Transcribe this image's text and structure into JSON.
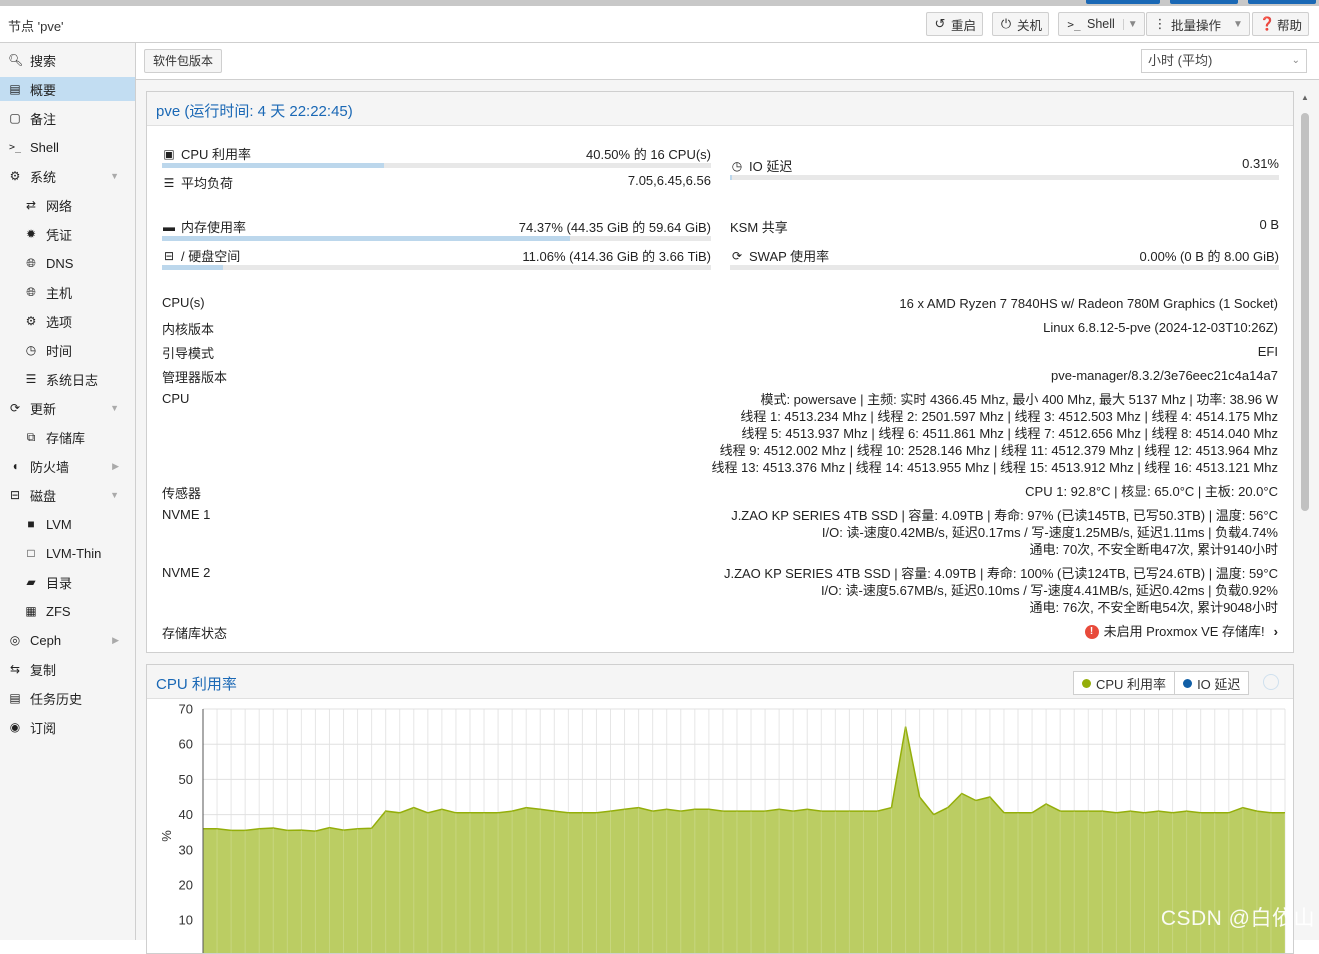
{
  "window": {
    "title": "节点 'pve'"
  },
  "header_buttons": {
    "restart": "重启",
    "shutdown": "关机",
    "shell": "Shell",
    "bulk": "批量操作",
    "help": "帮助"
  },
  "sidebar": {
    "items": [
      {
        "label": "搜索",
        "icon": "search-icon"
      },
      {
        "label": "概要",
        "icon": "book-icon"
      },
      {
        "label": "备注",
        "icon": "note-icon"
      },
      {
        "label": "Shell",
        "icon": "terminal-icon"
      },
      {
        "label": "系统",
        "icon": "gears-icon"
      },
      {
        "label": "网络",
        "icon": "exchange-icon"
      },
      {
        "label": "凭证",
        "icon": "certificate-icon"
      },
      {
        "label": "DNS",
        "icon": "globe-icon"
      },
      {
        "label": "主机",
        "icon": "globe-icon"
      },
      {
        "label": "选项",
        "icon": "gear-icon"
      },
      {
        "label": "时间",
        "icon": "clock-icon"
      },
      {
        "label": "系统日志",
        "icon": "list-icon"
      },
      {
        "label": "更新",
        "icon": "refresh-icon"
      },
      {
        "label": "存储库",
        "icon": "files-icon"
      },
      {
        "label": "防火墙",
        "icon": "shield-icon"
      },
      {
        "label": "磁盘",
        "icon": "hdd-icon"
      },
      {
        "label": "LVM",
        "icon": "square-icon"
      },
      {
        "label": "LVM-Thin",
        "icon": "square-outline-icon"
      },
      {
        "label": "目录",
        "icon": "folder-icon"
      },
      {
        "label": "ZFS",
        "icon": "grid-icon"
      },
      {
        "label": "Ceph",
        "icon": "ceph-icon"
      },
      {
        "label": "复制",
        "icon": "retweet-icon"
      },
      {
        "label": "任务历史",
        "icon": "list-alt-icon"
      },
      {
        "label": "订阅",
        "icon": "support-icon"
      }
    ]
  },
  "toolbar": {
    "package_versions": "软件包版本",
    "timeframe": "小时 (平均)"
  },
  "status": {
    "title": "pve (运行时间: 4 天 22:22:45)",
    "cpu": {
      "label": "CPU 利用率",
      "value": "40.50% 的 16 CPU(s)",
      "fraction": 0.405
    },
    "load": {
      "label": "平均负荷",
      "value": "7.05,6.45,6.56"
    },
    "io": {
      "label": "IO 延迟",
      "value": "0.31%",
      "fraction": 0.0031
    },
    "mem": {
      "label": "内存使用率",
      "value": "74.37% (44.35 GiB 的 59.64 GiB)",
      "fraction": 0.7437
    },
    "ksm": {
      "label": "KSM 共享",
      "value": "0 B"
    },
    "disk": {
      "label": "/ 硬盘空间",
      "value": "11.06% (414.36 GiB 的 3.66 TiB)",
      "fraction": 0.1106
    },
    "swap": {
      "label": "SWAP 使用率",
      "value": "0.00% (0 B 的 8.00 GiB)",
      "fraction": 0.0
    },
    "info": {
      "cpus_label": "CPU(s)",
      "cpus_value": "16 x AMD Ryzen 7 7840HS w/ Radeon 780M Graphics (1 Socket)",
      "kernel_label": "内核版本",
      "kernel_value": "Linux 6.8.12-5-pve (2024-12-03T10:26Z)",
      "boot_label": "引导模式",
      "boot_value": "EFI",
      "manager_label": "管理器版本",
      "manager_value": "pve-manager/8.3.2/3e76eec21c4a14a7",
      "cpu_label": "CPU",
      "cpu_line1": "模式: powersave | 主频: 实时 4366.45 Mhz, 最小 400 Mhz, 最大 5137 Mhz | 功率: 38.96 W",
      "cpu_line2": "线程 1: 4513.234 Mhz | 线程 2: 2501.597 Mhz | 线程 3: 4512.503 Mhz | 线程 4: 4514.175 Mhz",
      "cpu_line3": "线程 5: 4513.937 Mhz | 线程 6: 4511.861 Mhz | 线程 7: 4512.656 Mhz | 线程 8: 4514.040 Mhz",
      "cpu_line4": "线程 9: 4512.002 Mhz | 线程 10: 2528.146 Mhz | 线程 11: 4512.379 Mhz | 线程 12: 4513.964 Mhz",
      "cpu_line5": "线程 13: 4513.376 Mhz | 线程 14: 4513.955 Mhz | 线程 15: 4513.912 Mhz | 线程 16: 4513.121 Mhz",
      "sensor_label": "传感器",
      "sensor_value": "CPU 1: 92.8°C | 核显: 65.0°C | 主板: 20.0°C",
      "nvme1_label": "NVME 1",
      "nvme1_line1": "J.ZAO KP SERIES 4TB SSD | 容量: 4.09TB | 寿命: 97% (已读145TB, 已写50.3TB) | 温度: 56°C",
      "nvme1_line2": "I/O: 读-速度0.42MB/s, 延迟0.17ms / 写-速度1.25MB/s, 延迟1.11ms | 负载4.74%",
      "nvme1_line3": "通电: 70次, 不安全断电47次, 累计9140小时",
      "nvme2_label": "NVME 2",
      "nvme2_line1": "J.ZAO KP SERIES 4TB SSD | 容量: 4.09TB | 寿命: 100% (已读124TB, 已写24.6TB) | 温度: 59°C",
      "nvme2_line2": "I/O: 读-速度5.67MB/s, 延迟0.10ms / 写-速度4.41MB/s, 延迟0.42ms | 负载0.92%",
      "nvme2_line3": "通电: 76次, 不安全断电54次, 累计9048小时",
      "repo_label": "存储库状态",
      "repo_value": "未启用 Proxmox VE 存储库!"
    }
  },
  "chart_panel": {
    "title": "CPU 利用率",
    "legend_cpu": "CPU 利用率",
    "legend_io": "IO 延迟"
  },
  "colors": {
    "cpu_series": "#94ae0a",
    "cpu_fill": "#bbcd63",
    "io_series": "#115fa6",
    "accent": "#1a68b5"
  },
  "chart_data": {
    "type": "area",
    "ylabel": "%",
    "ylim": [
      0,
      70
    ],
    "yticks": [
      10,
      20,
      30,
      40,
      50,
      60,
      70
    ],
    "series": [
      {
        "name": "CPU 利用率",
        "values": [
          36,
          36,
          35.5,
          35.5,
          36,
          36.2,
          35.5,
          35.6,
          35.3,
          36.3,
          35.6,
          36,
          36.1,
          41,
          40.5,
          42,
          40.5,
          41.5,
          40.5,
          40.5,
          40.5,
          40.5,
          41,
          42,
          41.5,
          41,
          40.5,
          40.5,
          40.5,
          41,
          41.5,
          42,
          41,
          41.5,
          41,
          41.5,
          41.5,
          41,
          41,
          41,
          41,
          41.5,
          41,
          41.5,
          41,
          41,
          41,
          41,
          41,
          42,
          65,
          45,
          40,
          42,
          46,
          44,
          45,
          40.5,
          40.5,
          40.5,
          43,
          41,
          41,
          41,
          41,
          40.5,
          41,
          40.5,
          41,
          40.5,
          41,
          40.5,
          40.5,
          40.5,
          42,
          41,
          40.5,
          40.5
        ]
      },
      {
        "name": "IO 延迟",
        "values": []
      }
    ]
  },
  "watermark": "CSDN @白依山"
}
